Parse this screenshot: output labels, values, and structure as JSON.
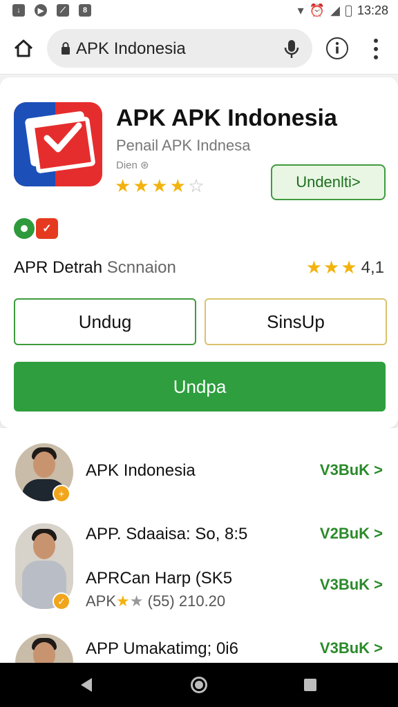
{
  "status_bar": {
    "time": "13:28"
  },
  "browser": {
    "url": "APK Indonesia"
  },
  "app": {
    "title": "APK APK Indonesia",
    "subtitle": "Penail APK Indnesa",
    "developer": "Dien",
    "rating_stars": 4,
    "install_label": "Undenlti>"
  },
  "details": {
    "label_main": "APR Detrah",
    "label_dim": "Scnnaion",
    "rating_value": "4,1"
  },
  "buttons": {
    "left": "Undug",
    "right": "SinsUp",
    "primary": "Undpa"
  },
  "list": {
    "items": [
      {
        "title": "APK Indonesia",
        "link": "V3BuK >"
      },
      {
        "title": "APP. Sdaaisa: So, 8:5",
        "link": "V2BuK >"
      },
      {
        "title": "APRCan Harp (SK5",
        "sub_prefix": "APK",
        "sub_rating": "(55) 210.20",
        "link": "V3BuK >"
      },
      {
        "title": "APP Umakatimg; 0i6",
        "link": "V3BuK >"
      }
    ]
  },
  "colors": {
    "accent_green": "#2e9e3e",
    "star_yellow": "#f2b30f",
    "icon_red": "#e62d2d",
    "icon_blue": "#1c4fb8"
  }
}
